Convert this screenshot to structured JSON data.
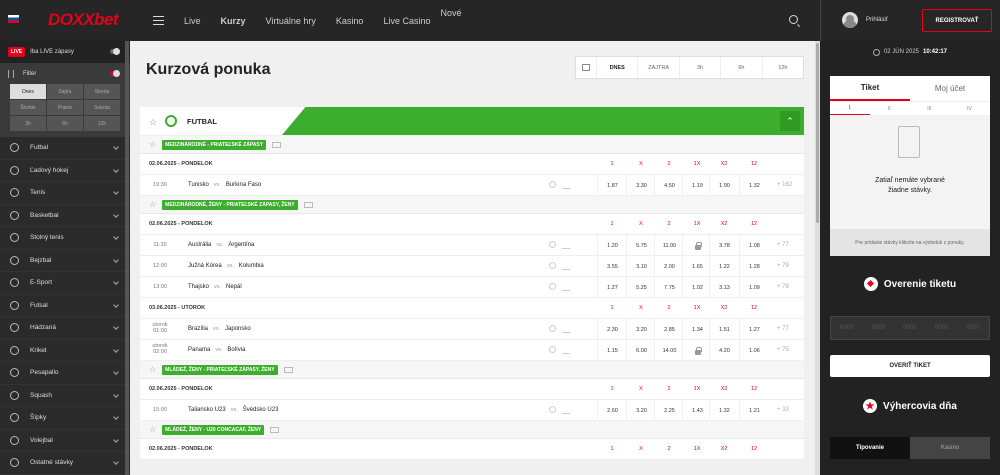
{
  "header": {
    "logo": "DOXXbet",
    "nav": [
      {
        "label": "Live",
        "active": false
      },
      {
        "label": "Kurzy",
        "active": true
      },
      {
        "label": "Virtuálne hry",
        "active": false
      },
      {
        "label": "Kasino",
        "active": false
      },
      {
        "label": "Live Casino",
        "active": false,
        "badge": "Nové"
      }
    ],
    "login_label": "Prihlásiť",
    "register_label": "REGISTROVAŤ"
  },
  "sidebar": {
    "live_badge": "LIVE",
    "live_only_label": "Iba LIVE zápasy",
    "filter_label": "Filter",
    "filter_days": [
      "Dnes",
      "Zajtra",
      "Streda",
      "Štvrtok",
      "Piatok",
      "Sobota",
      "3h",
      "6h",
      "12h"
    ],
    "filter_selected": "Dnes",
    "sports": [
      "Futbal",
      "Ľadový hokej",
      "Tenis",
      "Basketbal",
      "Stolný tenis",
      "Bejzbal",
      "E-Sport",
      "Futsal",
      "Hádzaná",
      "Kriket",
      "Pesapallo",
      "Squash",
      "Šípky",
      "Volejbal",
      "Ostatné stávky"
    ]
  },
  "main": {
    "title": "Kurzová ponuka",
    "time_filters": [
      "DNES",
      "ZAJTRA",
      "3h",
      "6h",
      "12h"
    ],
    "time_selected": "DNES",
    "sport_title": "FUTBAL",
    "odds_columns": [
      "1",
      "X",
      "2",
      "1X",
      "X2",
      "12"
    ],
    "sections": [
      {
        "league": "MEDZINÁRODNÉ - PRIATEĽSKÉ ZÁPASY",
        "groups": [
          {
            "date": "02.06.2025 - PONDELOK",
            "matches": [
              {
                "time": "19:30",
                "home": "Tunisko",
                "vs": "vs.",
                "away": "Burkina Faso",
                "odds": [
                  "1.87",
                  "3.30",
                  "4.50",
                  "1.19",
                  "1.90",
                  "1.32"
                ],
                "more": "+ 162"
              }
            ]
          }
        ]
      },
      {
        "league": "MEDZINÁRODNÉ, ŽENY - PRIATEĽSKÉ ZÁPASY, ŽENY",
        "groups": [
          {
            "date": "02.06.2025 - PONDELOK",
            "matches": [
              {
                "time": "11:30",
                "home": "Austrália",
                "vs": "vs.",
                "away": "Argentína",
                "odds": [
                  "1.20",
                  "5.75",
                  "11.00",
                  "",
                  "3.78",
                  "1.08"
                ],
                "more": "+ 77"
              },
              {
                "time": "12:00",
                "home": "Južná Kórea",
                "vs": "vs.",
                "away": "Kolumbia",
                "odds": [
                  "3.55",
                  "3.10",
                  "2.00",
                  "1.65",
                  "1.22",
                  "1.28"
                ],
                "more": "+ 79"
              },
              {
                "time": "13:00",
                "home": "Thajsko",
                "vs": "vs.",
                "away": "Nepál",
                "odds": [
                  "1.27",
                  "5.25",
                  "7.75",
                  "1.02",
                  "3.13",
                  "1.09"
                ],
                "more": "+ 78"
              }
            ]
          },
          {
            "date": "03.06.2025 - UTOROK",
            "matches": [
              {
                "time": "utorok",
                "time2": "01:00",
                "home": "Brazília",
                "vs": "vs.",
                "away": "Japonsko",
                "odds": [
                  "2.30",
                  "3.20",
                  "2.85",
                  "1.34",
                  "1.51",
                  "1.27"
                ],
                "more": "+ 77"
              },
              {
                "time": "utorok",
                "time2": "02:00",
                "home": "Panama",
                "vs": "vs.",
                "away": "Bolívia",
                "odds": [
                  "1.15",
                  "6.00",
                  "14.00",
                  "",
                  "4.20",
                  "1.06"
                ],
                "more": "+ 75"
              }
            ]
          }
        ]
      },
      {
        "league": "MLÁDEŽ, ŽENY - PRIATEĽSKÉ ZÁPASY, ŽENY",
        "groups": [
          {
            "date": "02.06.2025 - PONDELOK",
            "matches": [
              {
                "time": "15:00",
                "home": "Taliansko U23",
                "vs": "vs.",
                "away": "Švédsko U23",
                "odds": [
                  "2.60",
                  "3.20",
                  "2.25",
                  "1.43",
                  "1.32",
                  "1.21"
                ],
                "more": "+ 33"
              }
            ]
          }
        ]
      },
      {
        "league": "MLÁDEŽ, ŽENY - U20 CONCACAF, ŽENY",
        "groups": [
          {
            "date": "02.06.2025 - PONDELOK",
            "matches": []
          }
        ]
      }
    ]
  },
  "right": {
    "date": "02 JÚN 2025",
    "time": "10:42:17",
    "ticket_tab": "Tiket",
    "account_tab": "Moj účet",
    "ticket_nums": [
      "I.",
      "II.",
      "III.",
      "IV."
    ],
    "empty_text_1": "Zatiaľ nemáte vybrané",
    "empty_text_2": "žiadne stávky.",
    "hint": "Pre pridanie stávky kliknite na výsledok z ponuky.",
    "verify_title": "Overenie tiketu",
    "verify_button": "OVERIŤ TIKET",
    "winners_title": "Výhercovia dňa",
    "winners_tabs": [
      "Tipovanie",
      "Kasino"
    ]
  }
}
